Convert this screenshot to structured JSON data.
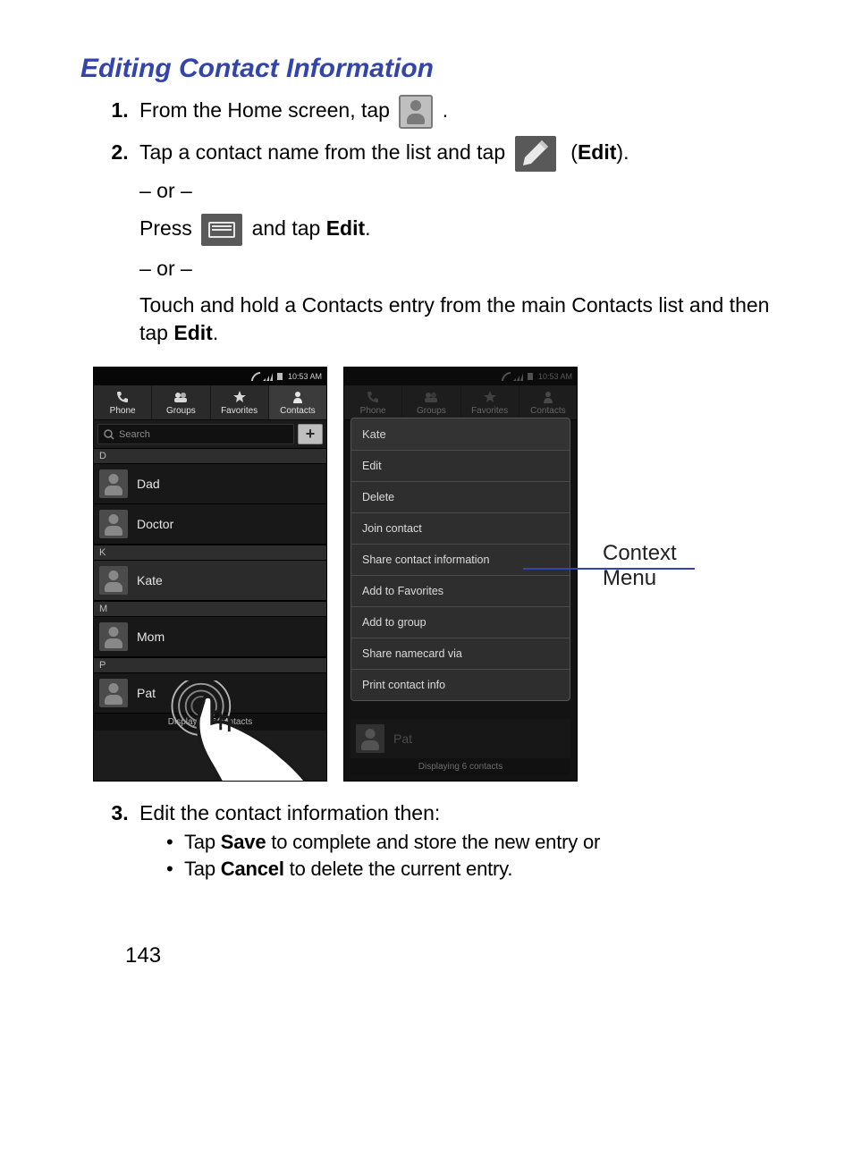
{
  "title": "Editing Contact Information",
  "steps": {
    "s1_a": "From the Home screen, tap ",
    "s1_b": " .",
    "s2_a": "Tap a contact name from the list and tap ",
    "s2_edit": "(Edit)",
    "s2_b": ".",
    "or": "– or –",
    "s2_alt1_a": "Press ",
    "s2_alt1_b": " and tap ",
    "s2_alt1_edit": "Edit",
    "s2_alt1_c": ".",
    "s2_alt2_a": "Touch and hold a Contacts entry from the main Contacts list and then tap ",
    "s2_alt2_edit": "Edit",
    "s2_alt2_b": ".",
    "s3": "Edit the contact information then:",
    "b1_a": "Tap ",
    "b1_bold": "Save",
    "b1_b": " to complete and store the new entry or",
    "b2_a": "Tap ",
    "b2_bold": "Cancel",
    "b2_b": " to delete the current entry."
  },
  "phone": {
    "time": "10:53 AM",
    "tabs": [
      "Phone",
      "Groups",
      "Favorites",
      "Contacts"
    ],
    "searchPlaceholder": "Search",
    "letters": [
      "D",
      "K",
      "M",
      "P"
    ],
    "contacts": [
      "Dad",
      "Doctor",
      "Kate",
      "Mom",
      "Pat"
    ],
    "footer": "Displaying 6 contacts"
  },
  "context_menu": {
    "title": "Kate",
    "items": [
      "Edit",
      "Delete",
      "Join contact",
      "Share contact information",
      "Add to Favorites",
      "Add to group",
      "Share namecard via",
      "Print contact info"
    ]
  },
  "callout": "Context Menu",
  "pageNumber": "143"
}
